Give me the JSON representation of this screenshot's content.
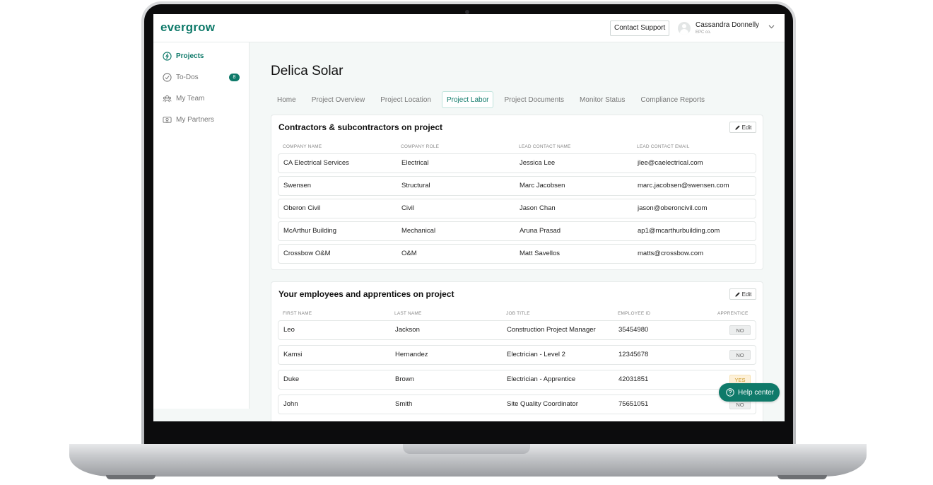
{
  "app": {
    "logo": "evergrow"
  },
  "header": {
    "support_label": "Contact Support",
    "user_name": "Cassandra Donnelly",
    "user_org": "EPC co."
  },
  "sidebar": {
    "items": [
      {
        "label": "Projects",
        "icon": "lightning-icon",
        "active": true
      },
      {
        "label": "To-Dos",
        "icon": "check-circle-icon",
        "badge": "8"
      },
      {
        "label": "My Team",
        "icon": "team-icon"
      },
      {
        "label": "My Partners",
        "icon": "handshake-icon"
      }
    ]
  },
  "page": {
    "title": "Delica Solar"
  },
  "tabs": [
    "Home",
    "Project Overview",
    "Project Location",
    "Project Labor",
    "Project Documents",
    "Monitor Status",
    "Compliance Reports"
  ],
  "active_tab": "Project Labor",
  "contractors": {
    "title": "Contractors & subcontractors on project",
    "edit_label": "Edit",
    "columns": [
      "Company Name",
      "Company Role",
      "Lead Contact Name",
      "Lead Contact Email"
    ],
    "rows": [
      [
        "CA Electrical Services",
        "Electrical",
        "Jessica Lee",
        "jlee@caelectrical.com"
      ],
      [
        "Swensen",
        "Structural",
        "Marc Jacobsen",
        "marc.jacobsen@swensen.com"
      ],
      [
        "Oberon Civil",
        "Civil",
        "Jason Chan",
        "jason@oberoncivil.com"
      ],
      [
        "McArthur Building",
        "Mechanical",
        "Aruna Prasad",
        "ap1@mcarthurbuilding.com"
      ],
      [
        "Crossbow O&M",
        "O&M",
        "Matt Savellos",
        "matts@crossbow.com"
      ]
    ]
  },
  "employees": {
    "title": "Your employees and apprentices on project",
    "edit_label": "Edit",
    "columns": [
      "First Name",
      "Last Name",
      "Job Title",
      "Employee ID",
      "Apprentice"
    ],
    "rows": [
      [
        "Leo",
        "Jackson",
        "Construction Project Manager",
        "35454980",
        "NO"
      ],
      [
        "Kamsi",
        "Hernandez",
        "Electrician - Level 2",
        "12345678",
        "NO"
      ],
      [
        "Duke",
        "Brown",
        "Electrician - Apprentice",
        "42031851",
        "YES"
      ],
      [
        "John",
        "Smith",
        "Site Quality Coordinator",
        "75651051",
        "NO"
      ]
    ]
  },
  "help": {
    "label": "Help center"
  },
  "colors": {
    "accent": "#0f7a6a",
    "background": "#f4f8f7",
    "yes_pill": "#fdf0d8"
  }
}
